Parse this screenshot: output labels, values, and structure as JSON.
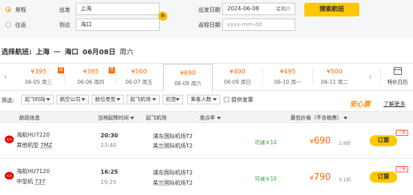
{
  "search": {
    "trip_types": [
      "单程",
      "往返"
    ],
    "from_label": "出发",
    "from_value": "上海",
    "to_label": "到达",
    "to_value": "海口",
    "swap_label": "换",
    "depart_date_label": "出发日期",
    "depart_date_value": "2024-06-08",
    "depart_weekday": "星期六",
    "return_date_label": "返程日期",
    "return_date_placeholder": "yyyy-mm-dd",
    "search_button": "搜索航班"
  },
  "title": {
    "prefix": "选择航班:",
    "from": "上海",
    "to": "海口",
    "date": "06月08日",
    "weekday": "周六"
  },
  "date_bar": {
    "days": [
      {
        "price": "¥395",
        "date": "06-05 周三",
        "low": true
      },
      {
        "price": "¥395",
        "date": "06-06 周四",
        "low": true
      },
      {
        "price": "¥560",
        "date": "06-07 周五",
        "low": false
      },
      {
        "price": "¥690",
        "date": "06-08 周六",
        "low": false
      },
      {
        "price": "¥400",
        "date": "06-09 周日",
        "low": false
      },
      {
        "price": "¥495",
        "date": "06-10 周一",
        "low": false
      },
      {
        "price": "¥500",
        "date": "06-11 周二",
        "low": false
      }
    ],
    "low_tag": "低",
    "calendar_label": "特价日历"
  },
  "filters": {
    "label": "筛选:",
    "dropdowns": [
      "起飞时段",
      "航空公司",
      "舱位类型",
      "起飞机场",
      "机型",
      "乘客人数"
    ],
    "checkbox_label": "提供发票",
    "brand": "安心票",
    "learn_more": "了解更多"
  },
  "table": {
    "headers": [
      "航班信息",
      "当地起降时间",
      "起飞机场",
      "准点率",
      "最低价格（不含税费）"
    ]
  },
  "flights": [
    {
      "airline": "海航HU7220",
      "model_prefix": "其他机型",
      "model_code": "7MZ",
      "dep_time": "20:30",
      "arr_time": "23:40",
      "dep_airport": "浦东国际机场T2",
      "arr_airport": "美兰国际机场T2",
      "discount": "可减￥10",
      "price_symbol": "¥",
      "price": "690",
      "rate": "2.8折",
      "book": "订票",
      "few": "少量"
    },
    {
      "airline": "海航HU7120",
      "model_prefix": "中型机",
      "model_code": "737",
      "dep_time": "16:25",
      "arr_time": "19:25",
      "dep_airport": "浦东国际机场T2",
      "arr_airport": "美兰国际机场T2",
      "discount": "可减￥10",
      "price_symbol": "¥",
      "price": "790",
      "rate": "3.1折",
      "book": "订票",
      "few": "少量"
    }
  ],
  "colors": {
    "accent": "#ffc800",
    "price": "#ff6600",
    "discount": "#3a9a3a",
    "brand_orange": "#ff8c00"
  }
}
